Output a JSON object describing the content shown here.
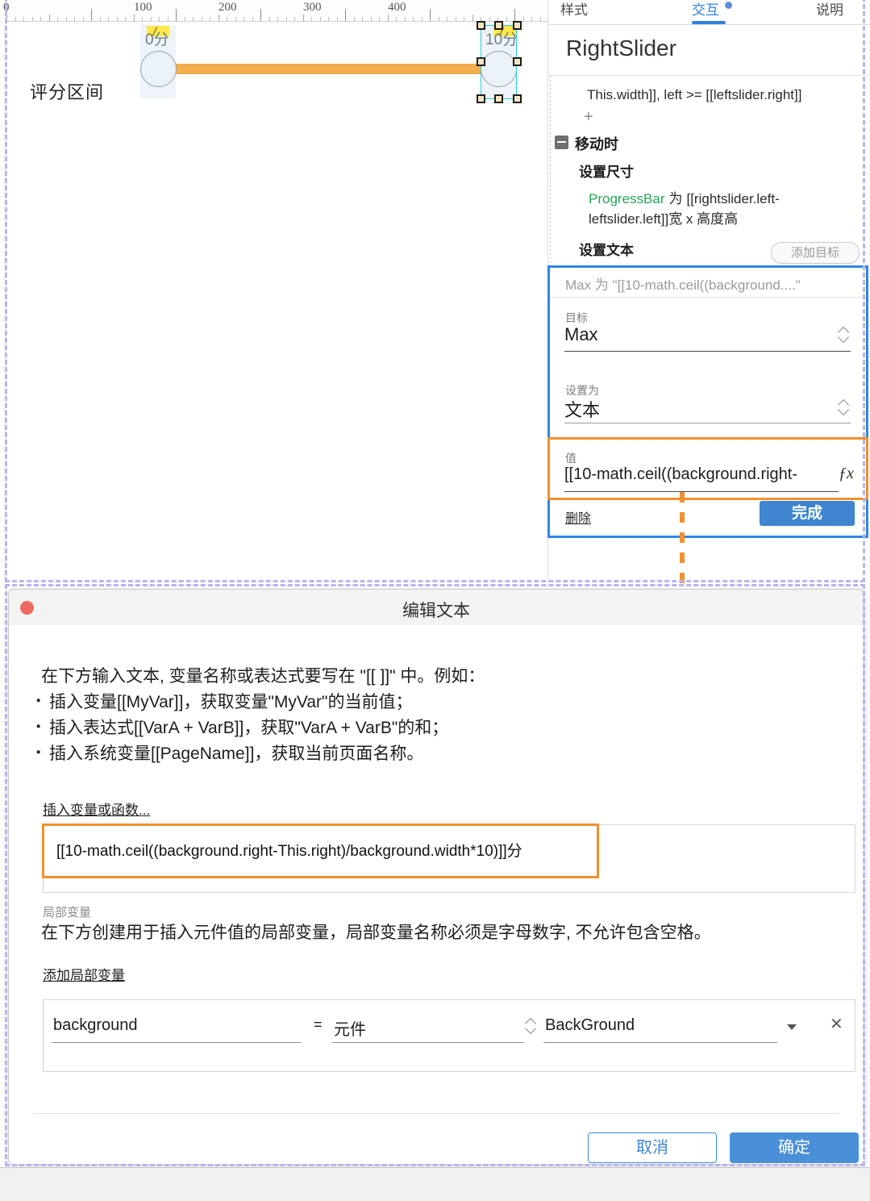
{
  "canvas": {
    "ruler": {
      "labels": [
        "0",
        "100",
        "200",
        "300",
        "400"
      ],
      "positions": [
        8,
        170,
        275,
        380,
        485
      ]
    },
    "label_score_range": "评分区间",
    "left_slider": {
      "text": "0分"
    },
    "right_slider": {
      "text": "10分"
    }
  },
  "panel": {
    "tabs": [
      {
        "label": "样式",
        "active": false
      },
      {
        "label": "交互",
        "active": true
      },
      {
        "label": "说明",
        "active": false
      }
    ],
    "title": "RightSlider",
    "condition_tail": "This.width]], left >= [[leftslider.right]]",
    "add_case_plus": "+",
    "event_move": "移动时",
    "action_set_size": "设置尺寸",
    "set_size_target": "ProgressBar",
    "set_size_for": "为",
    "set_size_value_line1": "[[rightslider.left-",
    "set_size_value_line2": "leftslider.left]]宽 x 高度高",
    "action_set_text": "设置文本",
    "add_target_button": "添加目标",
    "bottom_plus": "+"
  },
  "action_editor": {
    "summary": "Max 为 \"[[10-math.ceil((background....\"",
    "target_label": "目标",
    "target_value": "Max",
    "setto_label": "设置为",
    "setto_value": "文本",
    "value_label": "值",
    "value_value": "[[10-math.ceil((background.right-",
    "fx_icon": "ƒx",
    "delete_link": "删除",
    "done_button": "完成"
  },
  "dialog": {
    "title": "编辑文本",
    "help_lines": [
      "在下方输入文本, 变量名称或表达式要写在 \"[[ ]]\" 中。例如：",
      "插入变量[[MyVar]]，获取变量\"MyVar\"的当前值；",
      "插入表达式[[VarA + VarB]]，获取\"VarA + VarB\"的和；",
      "插入系统变量[[PageName]]，获取当前页面名称。"
    ],
    "insert_link": "插入变量或函数...",
    "expression": "[[10-math.ceil((background.right-This.right)/background.width*10)]]分",
    "local_var_section_label": "局部变量",
    "local_var_desc": "在下方创建用于插入元件值的局部变量，局部变量名称必须是字母数字, 不允许包含空格。",
    "add_local_var_link": "添加局部变量",
    "local_var_row": {
      "name": "background",
      "equals": "=",
      "type": "元件",
      "widget": "BackGround",
      "remove": "✕"
    },
    "cancel_button": "取消",
    "ok_button": "确定"
  },
  "colors": {
    "accent_blue": "#2f86e8",
    "highlight_orange": "#f0912e",
    "slider_bar": "#f3ae4e",
    "annotation_purple": "#b9b4f0",
    "primary_button": "#4a90d9",
    "green_target": "#25a55a"
  }
}
